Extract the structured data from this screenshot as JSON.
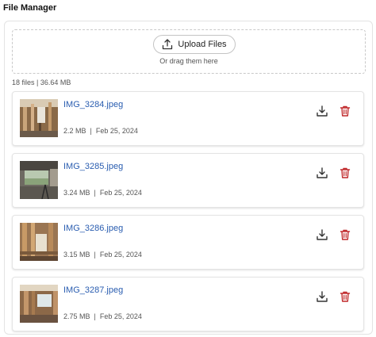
{
  "header": {
    "title": "File Manager"
  },
  "upload": {
    "button_label": "Upload Files",
    "hint": "Or drag them here",
    "icon": "upload-icon"
  },
  "summary": "18 files | 36.64 MB",
  "colors": {
    "link": "#2a5db0",
    "delete": "#c0282a",
    "icon": "#333333"
  },
  "files": [
    {
      "name": "IMG_3284.jpeg",
      "size": "2.2 MB",
      "date": "Feb 25, 2024",
      "meta": "2.2 MB  |  Feb 25, 2024"
    },
    {
      "name": "IMG_3285.jpeg",
      "size": "3.24 MB",
      "date": "Feb 25, 2024",
      "meta": "3.24 MB  |  Feb 25, 2024"
    },
    {
      "name": "IMG_3286.jpeg",
      "size": "3.15 MB",
      "date": "Feb 25, 2024",
      "meta": "3.15 MB  |  Feb 25, 2024"
    },
    {
      "name": "IMG_3287.jpeg",
      "size": "2.75 MB",
      "date": "Feb 25, 2024",
      "meta": "2.75 MB  |  Feb 25, 2024"
    }
  ],
  "icons": {
    "download": "download-icon",
    "delete": "trash-icon"
  }
}
